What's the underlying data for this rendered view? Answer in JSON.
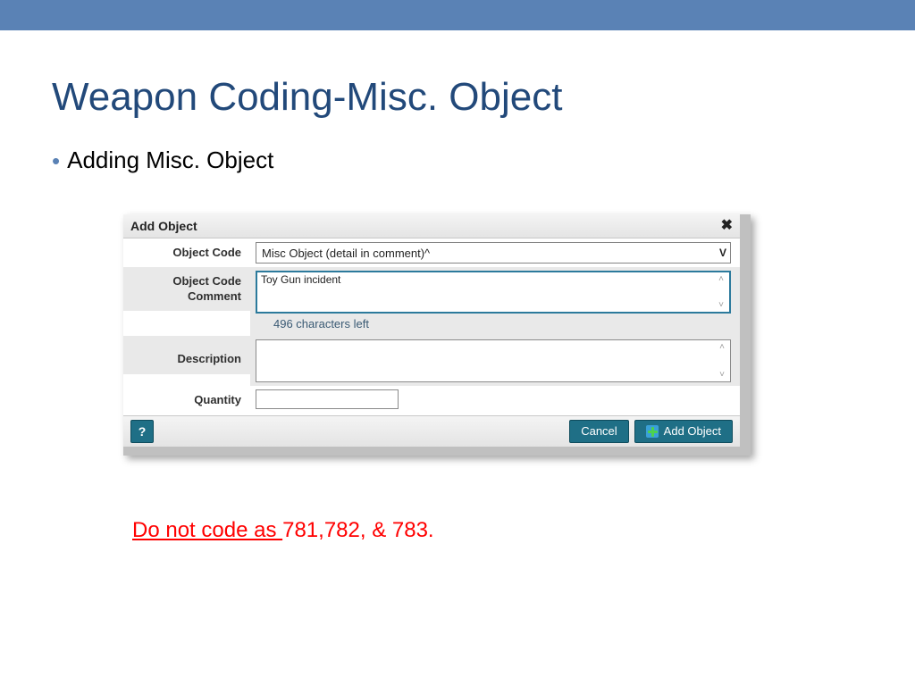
{
  "slide": {
    "title": "Weapon Coding-Misc. Object",
    "bullet1": "Adding Misc. Object"
  },
  "dialog": {
    "title": "Add Object",
    "close_glyph": "✖",
    "labels": {
      "object_code": "Object Code",
      "object_code_comment": "Object Code Comment",
      "description": "Description",
      "quantity": "Quantity"
    },
    "object_code_value": "Misc Object (detail in comment)^",
    "object_code_comment_value": "Toy Gun incident",
    "chars_left": "496 characters left",
    "description_value": "",
    "quantity_value": "",
    "footer": {
      "help": "?",
      "cancel": "Cancel",
      "add": "Add Object"
    }
  },
  "warning": {
    "underlined": "Do not code as ",
    "rest": "781,782,  & 783."
  }
}
